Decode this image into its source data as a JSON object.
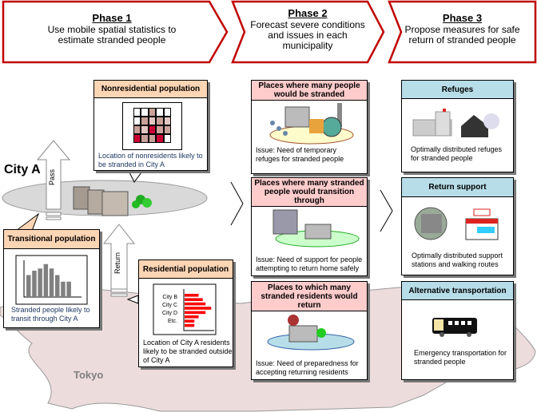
{
  "phases": [
    {
      "title": "Phase 1",
      "text": "Use mobile spatial statistics to estimate stranded people"
    },
    {
      "title": "Phase 2",
      "text": "Forecast severe conditions and issues in each municipality"
    },
    {
      "title": "Phase 3",
      "text": "Propose measures for safe return of stranded people"
    }
  ],
  "colors": {
    "phase_border": "#c00000",
    "pop_header": "#fcd5b4",
    "issue_header": "#ffcccc",
    "measure_header": "#b7dde8",
    "tokyo": "#eddcdc",
    "city": "#d9d9d9",
    "heat_high": "#cc0033",
    "heat_mid": "#c9a09a",
    "heat_low": "#e2c6c2",
    "bar_red": "#ff0000",
    "bar_gray": "#808080"
  },
  "city": {
    "label": "City A",
    "pass": "Pass",
    "return": "Return",
    "tokyo": "Tokyo"
  },
  "nonresidential": {
    "title": "Nonresidential population",
    "caption": "Location of nonresidents likely to be stranded in City A",
    "grid": [
      [
        0,
        0,
        2,
        0,
        0
      ],
      [
        0,
        2,
        1,
        2,
        1
      ],
      [
        2,
        1,
        3,
        2,
        2
      ],
      [
        3,
        2,
        2,
        3,
        0
      ]
    ]
  },
  "transitional": {
    "title": "Transitional population",
    "caption": "Stranded people likely to transit through City A",
    "bars": [
      5,
      6,
      6.5,
      7.5,
      6.5,
      5,
      3.5,
      3.5
    ]
  },
  "residential": {
    "title": "Residential population",
    "caption": "Location of City A residents likely to be stranded outside of City A",
    "labels": [
      "City B",
      "City C",
      "City D",
      "Etc."
    ],
    "bars": [
      5,
      6.5,
      7.5,
      9.5,
      7.5,
      5,
      3.5,
      3.5
    ]
  },
  "issues": [
    {
      "title": "Places where many people would be stranded",
      "text": "Issue: Need of temporary refuges for stranded people"
    },
    {
      "title": "Places where many stranded people would transition through",
      "text": "Issue: Need of support for people attempting to return home safely"
    },
    {
      "title": "Places to which many stranded residents would return",
      "text": "Issue: Need of preparedness for accepting returning residents"
    }
  ],
  "measures": [
    {
      "title": "Refuges",
      "text": "Optimally distributed refuges for stranded people"
    },
    {
      "title": "Return support",
      "text": "Optimally distributed support stations and walking routes"
    },
    {
      "title": "Alternative transportation",
      "text": "Emergency transportation for stranded people"
    }
  ]
}
